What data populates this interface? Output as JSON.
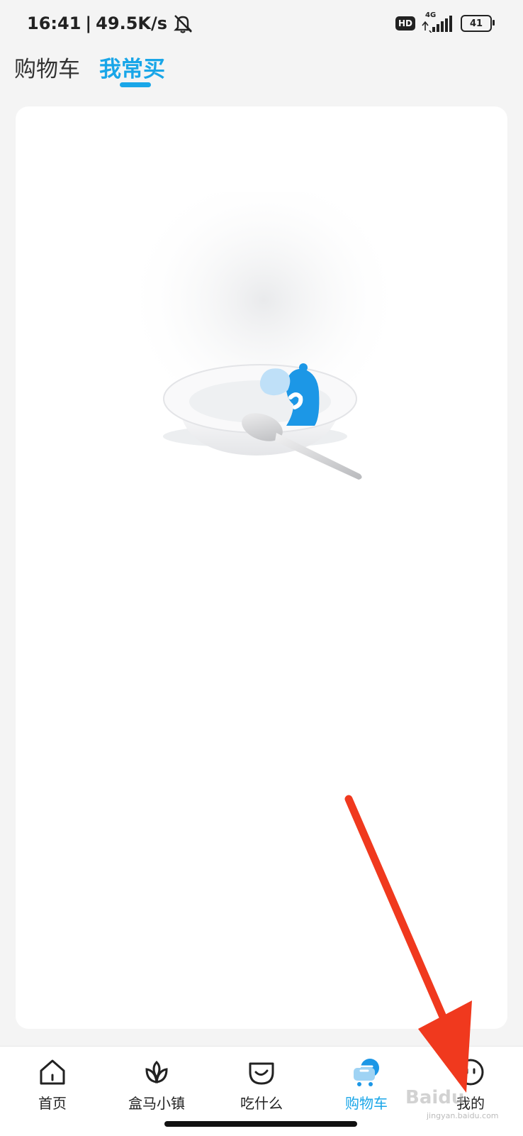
{
  "status_bar": {
    "time": "16:41",
    "net_speed": "49.5K/s",
    "hd": "HD",
    "network": "4G",
    "battery": "41"
  },
  "tabs": [
    {
      "label": "购物车"
    },
    {
      "label": "我常买"
    }
  ],
  "active_tab": "我常买",
  "bottom_nav": [
    {
      "label": "首页",
      "icon": "home-icon"
    },
    {
      "label": "盒马小镇",
      "icon": "flower-icon"
    },
    {
      "label": "吃什么",
      "icon": "bowl-icon"
    },
    {
      "label": "购物车",
      "icon": "cart-icon"
    },
    {
      "label": "我的",
      "icon": "face-icon"
    }
  ],
  "active_nav": "购物车",
  "colors": {
    "accent": "#19a6e8",
    "annotation_arrow": "#f0391e"
  },
  "watermark": {
    "brand": "Baidu",
    "sub": "jingyan.baidu.com"
  }
}
